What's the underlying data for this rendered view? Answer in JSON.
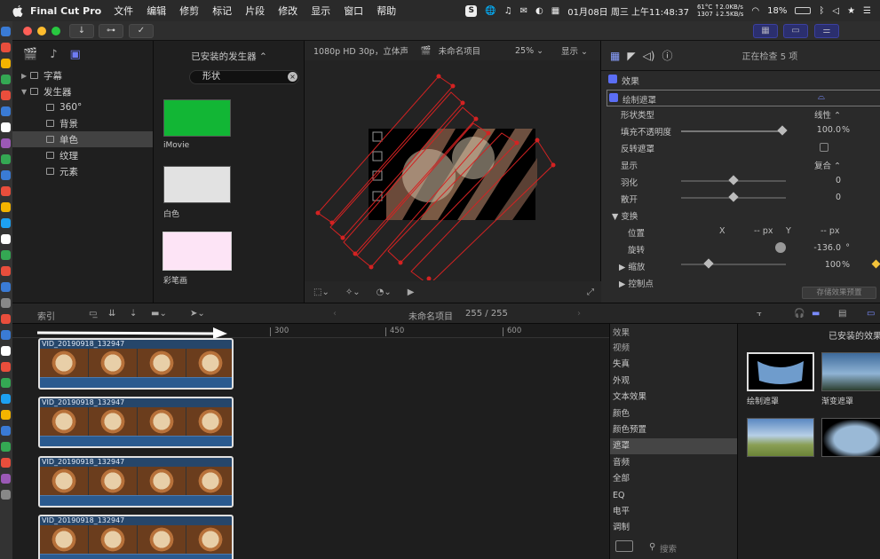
{
  "menubar": {
    "app": "Final Cut Pro",
    "items": [
      "文件",
      "编辑",
      "修剪",
      "标记",
      "片段",
      "修改",
      "显示",
      "窗口",
      "帮助"
    ],
    "net_top": "61°C ↑2.0KB/s",
    "net_bottom": "1307 ↓2.5KB/s",
    "clock": "01月08日 周三 上午11:48:37",
    "battery": "18%"
  },
  "libraries": {
    "rows": [
      {
        "label": "字幕",
        "arrow": "▶",
        "indent": 10,
        "sel": false
      },
      {
        "label": "发生器",
        "arrow": "▼",
        "indent": 10,
        "sel": false
      },
      {
        "label": "360°",
        "arrow": "",
        "indent": 28,
        "sel": false
      },
      {
        "label": "背景",
        "arrow": "",
        "indent": 28,
        "sel": false
      },
      {
        "label": "单色",
        "arrow": "",
        "indent": 28,
        "sel": true
      },
      {
        "label": "纹理",
        "arrow": "",
        "indent": 28,
        "sel": false
      },
      {
        "label": "元素",
        "arrow": "",
        "indent": 28,
        "sel": false
      }
    ]
  },
  "generators": {
    "title": "已安装的发生器 ⌃",
    "search_value": "形状",
    "items": [
      {
        "label": "iMovie",
        "color": "#12b635"
      },
      {
        "label": "白色",
        "color": "#e2e2e2"
      },
      {
        "label": "彩笔画",
        "color": "#fde4f6"
      }
    ]
  },
  "viewer": {
    "format": "1080p HD 30p，立体声",
    "project": "未命名项目",
    "zoom": "25% ⌄",
    "display": "显示 ⌄"
  },
  "inspector": {
    "status": "正在检查 5 项",
    "effects_label": "效果",
    "mask_label": "绘制遮罩",
    "rows": [
      {
        "label": "形状类型",
        "value": "线性 ⌃",
        "unit": ""
      },
      {
        "label": "填充不透明度",
        "value": "100.0",
        "unit": "%"
      },
      {
        "label": "反转遮罩",
        "value": "",
        "unit": ""
      },
      {
        "label": "显示",
        "value": "复合 ⌃",
        "unit": ""
      },
      {
        "label": "羽化",
        "value": "0",
        "unit": ""
      },
      {
        "label": "散开",
        "value": "0",
        "unit": ""
      },
      {
        "label": "▼ 变换",
        "value": "",
        "unit": ""
      },
      {
        "label": "位置",
        "value": "",
        "unit": ""
      },
      {
        "label": "旋转",
        "value": "-136.0",
        "unit": "°"
      },
      {
        "label": "▶ 缩放",
        "value": "100",
        "unit": "%"
      },
      {
        "label": "▶ 控制点",
        "value": "",
        "unit": ""
      }
    ],
    "pos_x_label": "X",
    "pos_x_value": "-- px",
    "pos_y_label": "Y",
    "pos_y_value": "-- px",
    "save_preset": "存储效果预置"
  },
  "timeline_bar": {
    "index": "索引",
    "project": "未命名项目",
    "count": "255 / 255"
  },
  "ruler": [
    "300",
    "450",
    "600"
  ],
  "clips": [
    "VID_20190918_132947",
    "VID_20190918_132947",
    "VID_20190918_132947",
    "VID_20190918_132947"
  ],
  "effects_browser": {
    "header": "效果",
    "title": "已安装的效果",
    "categories": [
      "视频",
      "失真",
      "外观",
      "文本效果",
      "颜色",
      "颜色预置",
      "遮罩",
      "音频",
      "全部",
      "EQ",
      "电平",
      "调制"
    ],
    "selected": "遮罩",
    "search_placeholder": "搜索",
    "items": [
      "绘制遮罩",
      "渐变遮罩"
    ]
  }
}
